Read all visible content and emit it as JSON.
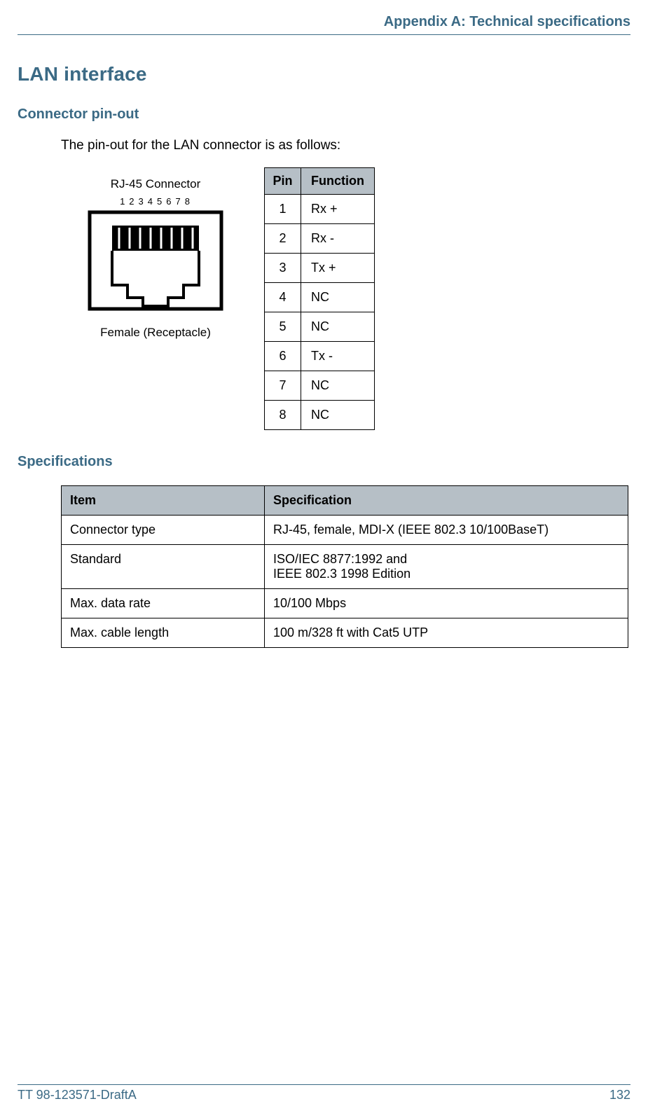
{
  "header": {
    "chapter": "Appendix A: Technical specifications"
  },
  "section": {
    "title": "LAN interface"
  },
  "pinout": {
    "heading": "Connector pin-out",
    "intro": "The pin-out for the LAN connector is as follows:",
    "connector_label_top": "RJ-45 Connector",
    "connector_label_bottom": "Female (Receptacle)",
    "table_headers": {
      "pin": "Pin",
      "function": "Function"
    },
    "rows": [
      {
        "pin": "1",
        "func": "Rx +"
      },
      {
        "pin": "2",
        "func": "Rx -"
      },
      {
        "pin": "3",
        "func": "Tx +"
      },
      {
        "pin": "4",
        "func": "NC"
      },
      {
        "pin": "5",
        "func": "NC"
      },
      {
        "pin": "6",
        "func": "Tx -"
      },
      {
        "pin": "7",
        "func": "NC"
      },
      {
        "pin": "8",
        "func": "NC"
      }
    ]
  },
  "specs": {
    "heading": "Specifications",
    "headers": {
      "item": "Item",
      "spec": "Specification"
    },
    "rows": [
      {
        "item": "Connector type",
        "spec": "RJ-45, female, MDI-X (IEEE 802.3 10/100BaseT)"
      },
      {
        "item": "Standard",
        "spec": "ISO/IEC 8877:1992 and\nIEEE 802.3 1998 Edition"
      },
      {
        "item": "Max. data rate",
        "spec": "10/100 Mbps"
      },
      {
        "item": "Max. cable length",
        "spec": "100 m/328 ft with Cat5 UTP"
      }
    ]
  },
  "footer": {
    "doc_id": "TT 98-123571-DraftA",
    "page": "132"
  },
  "diagram": {
    "pin_digits": "12345678"
  }
}
